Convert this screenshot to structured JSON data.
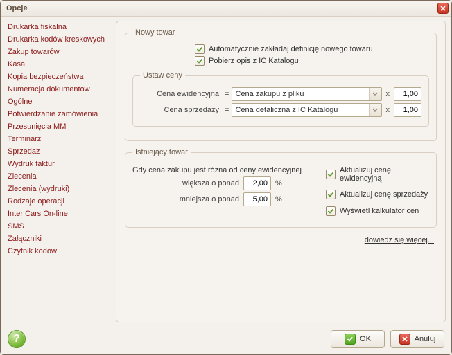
{
  "window": {
    "title": "Opcje"
  },
  "sidebar": {
    "items": [
      {
        "label": "Drukarka fiskalna"
      },
      {
        "label": "Drukarka kodów kreskowych"
      },
      {
        "label": "Zakup towarów"
      },
      {
        "label": "Kasa"
      },
      {
        "label": "Kopia bezpieczeństwa"
      },
      {
        "label": "Numeracja dokumentow"
      },
      {
        "label": "Ogólne"
      },
      {
        "label": "Potwierdzanie zamówienia"
      },
      {
        "label": "Przesunięcia MM"
      },
      {
        "label": "Terminarz"
      },
      {
        "label": "Sprzedaz"
      },
      {
        "label": "Wydruk faktur"
      },
      {
        "label": "Zlecenia"
      },
      {
        "label": "Zlecenia (wydruki)"
      },
      {
        "label": "Rodzaje operacji"
      },
      {
        "label": "Inter Cars On-line"
      },
      {
        "label": "SMS"
      },
      {
        "label": "Załączniki"
      },
      {
        "label": "Czytnik kodów"
      }
    ]
  },
  "new_item": {
    "legend": "Nowy towar",
    "auto_def": "Automatycznie zakładaj definicję nowego towaru",
    "get_desc": "Pobierz opis z IC Katalogu"
  },
  "set_prices": {
    "legend": "Ustaw ceny",
    "row1_label": "Cena ewidencyjna",
    "row1_value": "Cena zakupu z pliku",
    "row1_factor": "1,00",
    "row2_label": "Cena sprzedaży",
    "row2_value": "Cena detaliczna z IC Katalogu",
    "row2_factor": "1,00",
    "eq": "=",
    "x": "x"
  },
  "existing": {
    "legend": "Istniejący towar",
    "intro": "Gdy cena zakupu jest różna od ceny ewidencyjnej",
    "greater_label": "większa o ponad",
    "greater_value": "2,00",
    "less_label": "mniejsza o ponad",
    "less_value": "5,00",
    "pct": "%",
    "update_evid": "Aktualizuj cenę ewidencyjną",
    "update_sale": "Aktualizuj cenę sprzedaży",
    "show_calc": "Wyświetl kalkulator cen"
  },
  "learn_more": "dowiedz się więcej...",
  "footer": {
    "ok": "OK",
    "cancel": "Anuluj"
  }
}
